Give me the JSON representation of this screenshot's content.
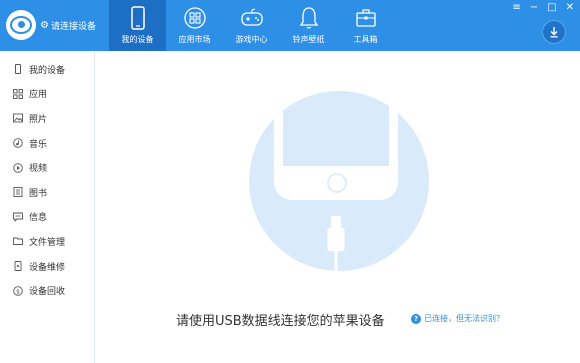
{
  "app": {
    "title": "请连接设备"
  },
  "nav": {
    "items": [
      {
        "label": "我的设备",
        "icon": "phone-icon",
        "active": true
      },
      {
        "label": "应用市场",
        "icon": "app-market-icon"
      },
      {
        "label": "游戏中心",
        "icon": "gamepad-icon"
      },
      {
        "label": "铃声壁纸",
        "icon": "bell-icon"
      },
      {
        "label": "工具箱",
        "icon": "toolbox-icon"
      }
    ]
  },
  "window_controls": {
    "menu": "≡",
    "minimize": "−",
    "maximize": "□",
    "close": "✕"
  },
  "sidebar": {
    "items": [
      {
        "label": "我的设备",
        "icon": "phone-icon"
      },
      {
        "label": "应用",
        "icon": "apps-icon"
      },
      {
        "label": "照片",
        "icon": "photo-icon"
      },
      {
        "label": "音乐",
        "icon": "music-icon"
      },
      {
        "label": "视频",
        "icon": "video-icon"
      },
      {
        "label": "图书",
        "icon": "book-icon"
      },
      {
        "label": "信息",
        "icon": "message-icon"
      },
      {
        "label": "文件管理",
        "icon": "folder-icon"
      },
      {
        "label": "设备维修",
        "icon": "wrench-icon"
      },
      {
        "label": "设备回收",
        "icon": "recycle-icon"
      }
    ]
  },
  "main": {
    "prompt": "请使用USB数据线连接您的苹果设备",
    "help_icon": "?",
    "help_link": "已连接，但无法识别？"
  },
  "colors": {
    "accent": "#2d8fe6",
    "active_tab": "#1c6fc4",
    "illustration": "#d9eafb"
  }
}
